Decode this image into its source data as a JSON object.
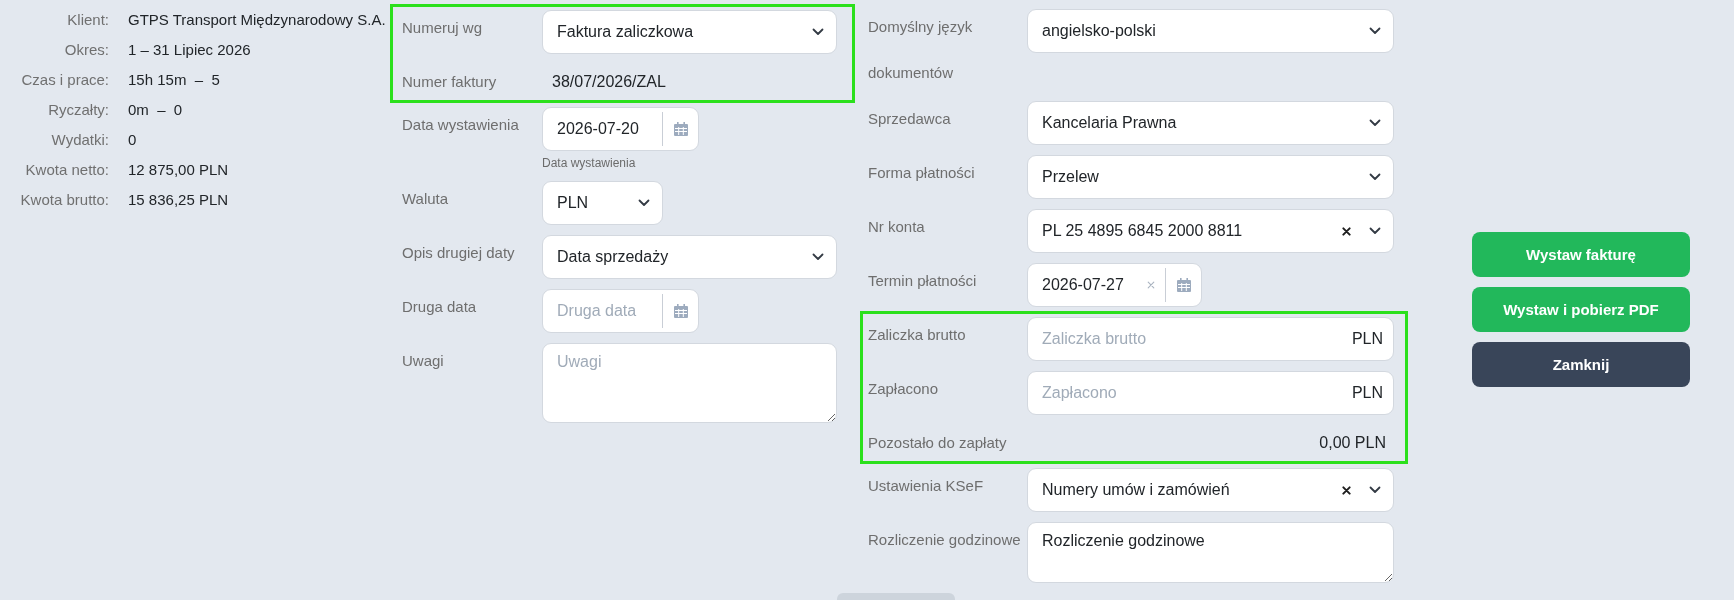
{
  "summary": [
    {
      "label": "Klient:",
      "value": "GTPS Transport Międzynarodowy S.A."
    },
    {
      "label": "Okres:",
      "value": "1 – 31 Lipiec 2026"
    },
    {
      "label": "Czas i prace:",
      "value": "15h 15m  –  5"
    },
    {
      "label": "Ryczałty:",
      "value": "0m  –  0"
    },
    {
      "label": "Wydatki:",
      "value": "0"
    },
    {
      "label": "Kwota netto:",
      "value": "12 875,00 PLN"
    },
    {
      "label": "Kwota brutto:",
      "value": "15 836,25 PLN"
    }
  ],
  "invoice_form": {
    "groups": [
      {
        "highlighted": true,
        "rows": [
          {
            "kind": "select",
            "label": "Numeruj wg",
            "value": "Faktura zaliczkowa",
            "clearable": false
          },
          {
            "kind": "static",
            "label": "Numer faktury",
            "value": "38/07/2026/ZAL"
          }
        ]
      },
      {
        "highlighted": false,
        "rows": [
          {
            "kind": "date",
            "label": "Data wystawienia",
            "value": "2026-07-20",
            "clearable": false,
            "helper": "Data wystawienia"
          },
          {
            "kind": "shortselect",
            "label": "Waluta",
            "value": "PLN",
            "clearable": false
          },
          {
            "kind": "select",
            "label": "Opis drugiej daty",
            "value": "Data sprzedaży",
            "clearable": false
          },
          {
            "kind": "date",
            "label": "Druga data",
            "placeholder": "Druga data",
            "clearable": false
          },
          {
            "kind": "textarea",
            "label": "Uwagi",
            "placeholder": "Uwagi"
          }
        ]
      }
    ]
  },
  "settings_form": {
    "groups": [
      {
        "highlighted": false,
        "rows": [
          {
            "kind": "select",
            "label": "Domyślny język dokumentów",
            "value": "angielsko-polski",
            "clearable": false
          },
          {
            "kind": "select",
            "label": "Sprzedawca",
            "value": "Kancelaria Prawna",
            "clearable": false
          },
          {
            "kind": "select",
            "label": "Forma płatności",
            "value": "Przelew",
            "clearable": false
          },
          {
            "kind": "select",
            "label": "Nr konta",
            "value": "PL 25 4895 6845 2000 8811",
            "clearable": true
          },
          {
            "kind": "date",
            "label": "Termin płatności",
            "value": "2026-07-27",
            "clearable": true
          }
        ]
      },
      {
        "highlighted": true,
        "rows": [
          {
            "kind": "amount",
            "label": "Zaliczka brutto",
            "placeholder": "Zaliczka brutto",
            "unit": "PLN"
          },
          {
            "kind": "amount",
            "label": "Zapłacono",
            "placeholder": "Zapłacono",
            "unit": "PLN"
          },
          {
            "kind": "total",
            "label": "Pozostało do zapłaty",
            "value": "0,00 PLN"
          }
        ]
      },
      {
        "highlighted": false,
        "rows": [
          {
            "kind": "select",
            "label": "Ustawienia KSeF",
            "value": "Numery umów i zamówień",
            "clearable": true
          },
          {
            "kind": "shorttextarea",
            "label": "Rozliczenie godzinowe",
            "value": "Rozliczenie godzinowe"
          }
        ]
      }
    ]
  },
  "buttons": [
    {
      "label": "Wystaw fakturę",
      "kind": "primary"
    },
    {
      "label": "Wystaw i pobierz PDF",
      "kind": "primary"
    },
    {
      "label": "Zamknij",
      "kind": "secondary"
    }
  ]
}
